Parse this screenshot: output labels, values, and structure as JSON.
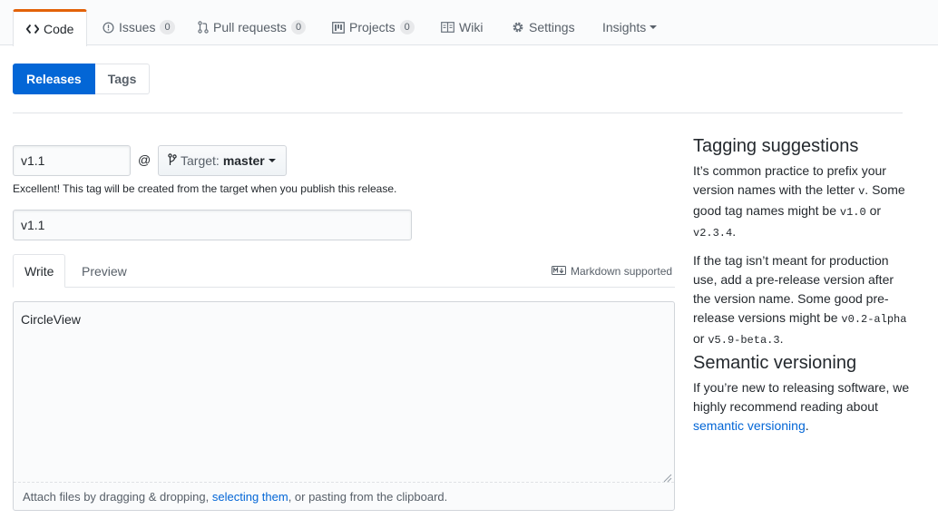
{
  "nav": {
    "tabs": [
      {
        "label": "Code",
        "icon": "code-icon"
      },
      {
        "label": "Issues",
        "count": "0",
        "icon": "issue-icon"
      },
      {
        "label": "Pull requests",
        "count": "0",
        "icon": "pull-request-icon"
      },
      {
        "label": "Projects",
        "count": "0",
        "icon": "project-icon"
      },
      {
        "label": "Wiki",
        "icon": "book-icon"
      },
      {
        "label": "Settings",
        "icon": "gear-icon"
      },
      {
        "label": "Insights"
      }
    ]
  },
  "subnav": {
    "releases": "Releases",
    "tags": "Tags"
  },
  "form": {
    "tag_value": "v1.1",
    "at": "@",
    "target_label": "Target:",
    "target_branch": "master",
    "tag_note": "Excellent! This tag will be created from the target when you publish this release.",
    "title_value": "v1.1"
  },
  "editor": {
    "write_tab": "Write",
    "preview_tab": "Preview",
    "markdown_note": "Markdown supported",
    "body": "CircleView",
    "attach_prefix": "Attach files by dragging & dropping, ",
    "attach_link": "selecting them",
    "attach_suffix": ", or pasting from the clipboard."
  },
  "sidebar": {
    "tagging_title": "Tagging suggestions",
    "tagging_p1_a": "It’s common practice to prefix your version names with the letter ",
    "tagging_p1_code_v": "v",
    "tagging_p1_b": ". Some good tag names might be ",
    "tagging_p1_code1": "v1.0",
    "tagging_p1_c": " or ",
    "tagging_p1_code2": "v2.3.4",
    "tagging_p1_d": ".",
    "tagging_p2_a": "If the tag isn’t meant for production use, add a pre-release version after the version name. Some good pre-release versions might be ",
    "tagging_p2_code1": "v0.2-alpha",
    "tagging_p2_b": " or ",
    "tagging_p2_code2": "v5.9-beta.3",
    "tagging_p2_c": ".",
    "semver_title": "Semantic versioning",
    "semver_p_a": "If you’re new to releasing software, we highly recommend reading about ",
    "semver_link": "semantic versioning",
    "semver_p_b": "."
  },
  "colors": {
    "accent": "#0366d6",
    "tab_highlight": "#e36209"
  }
}
